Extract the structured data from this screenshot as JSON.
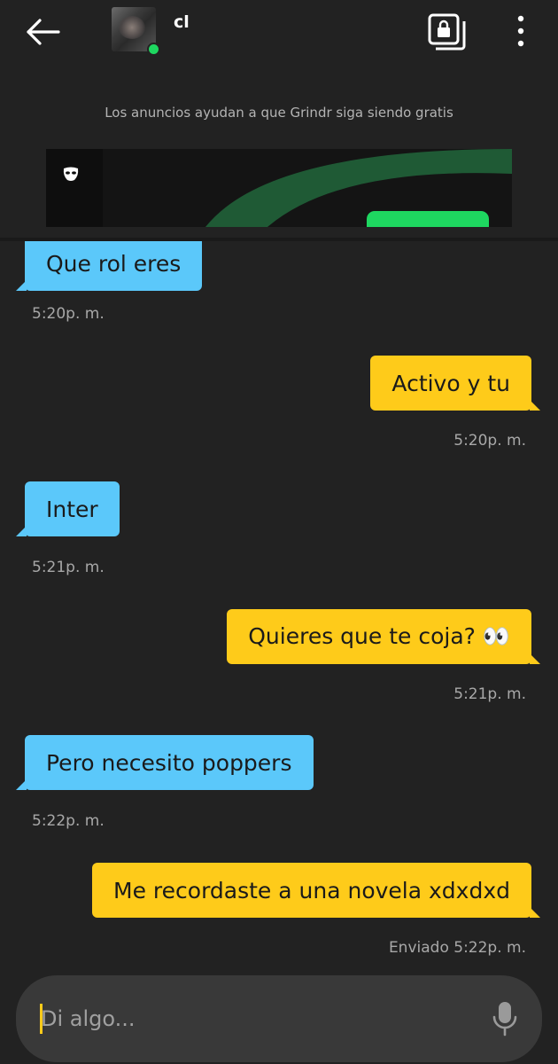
{
  "header": {
    "username": "cl",
    "online": true,
    "icons": {
      "back": "arrow-left-icon",
      "album": "private-album-icon",
      "more": "more-vertical-icon"
    }
  },
  "ad": {
    "note": "Los anuncios ayudan a que Grindr siga siendo gratis",
    "brand_icon": "grindr-mask-icon"
  },
  "colors": {
    "background": "#222222",
    "incoming_bubble": "#5bc8fa",
    "outgoing_bubble": "#fecb1a",
    "online": "#1ed760"
  },
  "messages": [
    {
      "direction": "in",
      "text": "Que rol eres",
      "time": "5:20p. m."
    },
    {
      "direction": "out",
      "text": "Activo y tu",
      "time": "5:20p. m."
    },
    {
      "direction": "in",
      "text": "Inter",
      "time": "5:21p. m."
    },
    {
      "direction": "out",
      "text": "Quieres que te coja? 👀",
      "time": "5:21p. m."
    },
    {
      "direction": "in",
      "text": "Pero necesito poppers",
      "time": "5:22p. m."
    },
    {
      "direction": "out",
      "text": "Me recordaste a una novela xdxdxd",
      "time": "Enviado  5:22p. m."
    }
  ],
  "composer": {
    "placeholder": "Di algo...",
    "mic_icon": "microphone-icon"
  }
}
